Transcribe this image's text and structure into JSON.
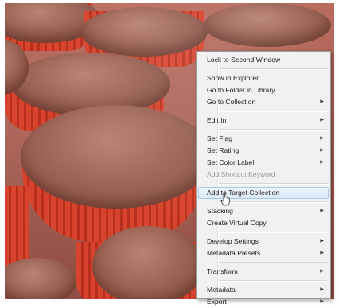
{
  "menu": {
    "groups": [
      [
        {
          "label": "Lock to Second Window",
          "submenu": false,
          "disabled": false
        }
      ],
      [
        {
          "label": "Show in Explorer",
          "submenu": false,
          "disabled": false
        },
        {
          "label": "Go to Folder in Library",
          "submenu": false,
          "disabled": false
        },
        {
          "label": "Go to Collection",
          "submenu": true,
          "disabled": false
        }
      ],
      [
        {
          "label": "Edit In",
          "submenu": true,
          "disabled": false
        }
      ],
      [
        {
          "label": "Set Flag",
          "submenu": true,
          "disabled": false
        },
        {
          "label": "Set Rating",
          "submenu": true,
          "disabled": false
        },
        {
          "label": "Set Color Label",
          "submenu": true,
          "disabled": false
        },
        {
          "label": "Add Shortcut Keyword",
          "submenu": false,
          "disabled": true
        }
      ],
      [
        {
          "label": "Add to Target Collection",
          "submenu": false,
          "disabled": false,
          "hover": true
        }
      ],
      [
        {
          "label": "Stacking",
          "submenu": true,
          "disabled": false
        },
        {
          "label": "Create Virtual Copy",
          "submenu": false,
          "disabled": false
        }
      ],
      [
        {
          "label": "Develop Settings",
          "submenu": true,
          "disabled": false
        },
        {
          "label": "Metadata Presets",
          "submenu": true,
          "disabled": false
        }
      ],
      [
        {
          "label": "Transform",
          "submenu": true,
          "disabled": false
        }
      ],
      [
        {
          "label": "Metadata",
          "submenu": true,
          "disabled": false
        },
        {
          "label": "Export",
          "submenu": true,
          "disabled": false
        }
      ]
    ],
    "submenu_icon": "triangle-right-icon"
  },
  "cursor_icon": "hand-pointer-icon",
  "photo_subject": "cupcakes"
}
